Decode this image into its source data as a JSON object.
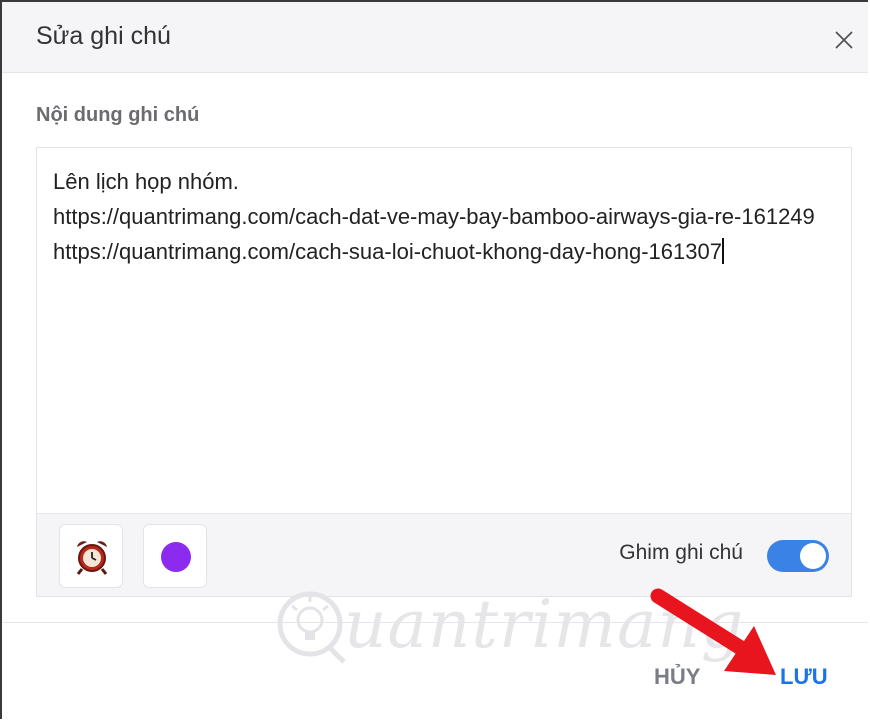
{
  "dialog": {
    "title": "Sửa ghi chú",
    "close_symbol": "×"
  },
  "content": {
    "label": "Nội dung ghi chú",
    "text": "Lên lịch họp nhóm.\nhttps://quantrimang.com/cach-dat-ve-may-bay-bamboo-airways-gia-re-161249\nhttps://quantrimang.com/cach-sua-loi-chuot-khong-day-hong-161307"
  },
  "toolbar": {
    "reminder_icon": "alarm-clock-icon",
    "color_value": "#8c2bef",
    "pin_label": "Ghim ghi chú",
    "pin_enabled": true,
    "toggle_color": "#3b82e6"
  },
  "actions": {
    "cancel_label": "HỦY",
    "save_label": "LƯU",
    "save_color": "#1a73e8"
  },
  "watermark": {
    "text": "uantrimang",
    "icon": "lightbulb-icon"
  },
  "annotation": {
    "arrow_color": "#e8141e",
    "icon": "red-arrow-icon"
  }
}
